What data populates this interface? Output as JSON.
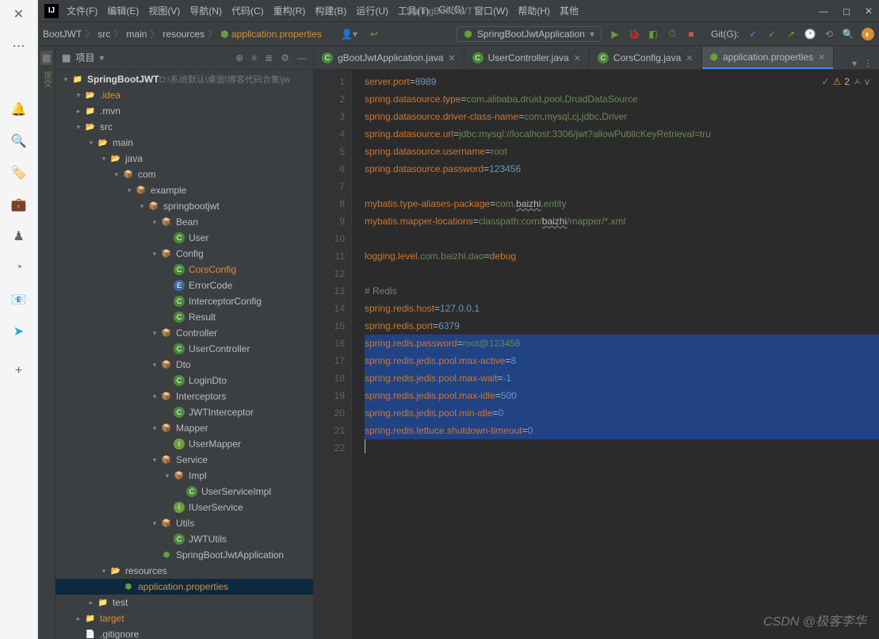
{
  "app_name": "SpringBootJWT",
  "menu": [
    "文件(F)",
    "编辑(E)",
    "视图(V)",
    "导航(N)",
    "代码(C)",
    "重构(R)",
    "构建(B)",
    "运行(U)",
    "工具(T)",
    "Git(G)",
    "窗口(W)",
    "帮助(H)",
    "其他"
  ],
  "crumbs": [
    "BootJWT",
    "src",
    "main",
    "resources",
    "application.properties"
  ],
  "run_config": "SpringBootJwtApplication",
  "git_label": "Git(G):",
  "project_label": "项目",
  "root": {
    "name": "SpringBootJWT",
    "path": "D:\\系统默认\\桌面\\博客代码合集\\jw"
  },
  "tree": [
    {
      "d": 1,
      "t": "folder",
      "open": true,
      "l": ".idea",
      "orange": true
    },
    {
      "d": 1,
      "t": "folder",
      "open": false,
      "l": ".mvn"
    },
    {
      "d": 1,
      "t": "folder",
      "open": true,
      "l": "src"
    },
    {
      "d": 2,
      "t": "folder",
      "open": true,
      "l": "main"
    },
    {
      "d": 3,
      "t": "folder",
      "open": true,
      "l": "java"
    },
    {
      "d": 4,
      "t": "pkg",
      "open": true,
      "l": "com"
    },
    {
      "d": 5,
      "t": "pkg",
      "open": true,
      "l": "example"
    },
    {
      "d": 6,
      "t": "pkg",
      "open": true,
      "l": "springbootjwt"
    },
    {
      "d": 7,
      "t": "pkg",
      "open": true,
      "l": "Bean"
    },
    {
      "d": 8,
      "t": "class",
      "l": "User"
    },
    {
      "d": 7,
      "t": "pkg",
      "open": true,
      "l": "Config"
    },
    {
      "d": 8,
      "t": "class",
      "l": "CorsConfig",
      "orange": true
    },
    {
      "d": 8,
      "t": "enum",
      "l": "ErrorCode"
    },
    {
      "d": 8,
      "t": "class",
      "l": "InterceptorConfig"
    },
    {
      "d": 8,
      "t": "class",
      "l": "Result"
    },
    {
      "d": 7,
      "t": "pkg",
      "open": true,
      "l": "Controller"
    },
    {
      "d": 8,
      "t": "class",
      "l": "UserController"
    },
    {
      "d": 7,
      "t": "pkg",
      "open": true,
      "l": "Dto"
    },
    {
      "d": 8,
      "t": "class",
      "l": "LoginDto"
    },
    {
      "d": 7,
      "t": "pkg",
      "open": true,
      "l": "Interceptors"
    },
    {
      "d": 8,
      "t": "class",
      "l": "JWTInterceptor"
    },
    {
      "d": 7,
      "t": "pkg",
      "open": true,
      "l": "Mapper"
    },
    {
      "d": 8,
      "t": "int",
      "l": "UserMapper"
    },
    {
      "d": 7,
      "t": "pkg",
      "open": true,
      "l": "Service"
    },
    {
      "d": 8,
      "t": "pkg",
      "open": true,
      "l": "Impl"
    },
    {
      "d": 9,
      "t": "class",
      "l": "UserServiceImpl"
    },
    {
      "d": 8,
      "t": "int",
      "l": "IUserService"
    },
    {
      "d": 7,
      "t": "pkg",
      "open": true,
      "l": "Utils"
    },
    {
      "d": 8,
      "t": "class",
      "l": "JWTUtils"
    },
    {
      "d": 7,
      "t": "spring",
      "l": "SpringBootJwtApplication"
    },
    {
      "d": 3,
      "t": "res",
      "open": true,
      "l": "resources"
    },
    {
      "d": 4,
      "t": "prop",
      "l": "application.properties",
      "orange": true,
      "sel": true
    },
    {
      "d": 2,
      "t": "folder",
      "open": false,
      "l": "test"
    },
    {
      "d": 1,
      "t": "folder",
      "open": false,
      "l": "target",
      "orange": true
    },
    {
      "d": 1,
      "t": "file",
      "l": ".gitignore"
    }
  ],
  "tabs": [
    {
      "l": "gBootJwtApplication.java",
      "ic": "class"
    },
    {
      "l": "UserController.java",
      "ic": "class"
    },
    {
      "l": "CorsConfig.java",
      "ic": "class"
    },
    {
      "l": "application.properties",
      "ic": "prop",
      "active": true
    }
  ],
  "warnings": "2",
  "code": [
    [
      [
        "k",
        "server.port"
      ],
      [
        "p",
        "="
      ],
      [
        "n",
        "8989"
      ]
    ],
    [
      [
        "k",
        "spring.datasource.type"
      ],
      [
        "p",
        "="
      ],
      [
        "v",
        "com"
      ],
      [
        "p",
        "."
      ],
      [
        "v",
        "alibaba"
      ],
      [
        "p",
        "."
      ],
      [
        "v",
        "druid"
      ],
      [
        "p",
        "."
      ],
      [
        "v",
        "pool"
      ],
      [
        "p",
        "."
      ],
      [
        "v",
        "DruidDataSource"
      ]
    ],
    [
      [
        "k",
        "spring.datasource.driver-class-name"
      ],
      [
        "p",
        "="
      ],
      [
        "v",
        "com"
      ],
      [
        "p",
        "."
      ],
      [
        "v",
        "mysql"
      ],
      [
        "p",
        "."
      ],
      [
        "v",
        "cj"
      ],
      [
        "p",
        "."
      ],
      [
        "v",
        "jdbc"
      ],
      [
        "p",
        "."
      ],
      [
        "v",
        "Driver"
      ]
    ],
    [
      [
        "k",
        "spring.datasource.url"
      ],
      [
        "p",
        "="
      ],
      [
        "v",
        "jdbc:mysql://localhost:3306/jwt?allowPublicKeyRetrieval=tru"
      ]
    ],
    [
      [
        "k",
        "spring.datasource.username"
      ],
      [
        "p",
        "="
      ],
      [
        "v",
        "root"
      ]
    ],
    [
      [
        "k",
        "spring.datasource.password"
      ],
      [
        "p",
        "="
      ],
      [
        "n",
        "123456"
      ]
    ],
    [],
    [
      [
        "k",
        "mybatis.type-aliases-package"
      ],
      [
        "p",
        "="
      ],
      [
        "v",
        "com"
      ],
      [
        "p",
        "."
      ],
      [
        "w",
        "baizhi"
      ],
      [
        "p",
        "."
      ],
      [
        "v",
        "entity"
      ]
    ],
    [
      [
        "k",
        "mybatis.mapper-locations"
      ],
      [
        "p",
        "="
      ],
      [
        "v",
        "classpath:com/"
      ],
      [
        "w",
        "baizhi"
      ],
      [
        "v",
        "/mapper/*.xml"
      ]
    ],
    [],
    [
      [
        "k",
        "logging.level."
      ],
      [
        "v",
        "com.baizhi.dao"
      ],
      [
        "p",
        "="
      ],
      [
        "k",
        "debug"
      ]
    ],
    [],
    [
      [
        "c",
        "# Redis"
      ]
    ],
    [
      [
        "k",
        "spring.redis.host"
      ],
      [
        "p",
        "="
      ],
      [
        "n",
        "127.0.0.1"
      ]
    ],
    [
      [
        "k",
        "spring.redis.port"
      ],
      [
        "p",
        "="
      ],
      [
        "n",
        "6379"
      ]
    ],
    [
      [
        "k",
        "spring.redis.password"
      ],
      [
        "p",
        "="
      ],
      [
        "v",
        "root@123456"
      ]
    ],
    [
      [
        "k",
        "spring.redis.jedis.pool.max-active"
      ],
      [
        "p",
        "="
      ],
      [
        "n",
        "8"
      ]
    ],
    [
      [
        "k",
        "spring.redis.jedis.pool.max-wait"
      ],
      [
        "p",
        "="
      ],
      [
        "n",
        "-1"
      ]
    ],
    [
      [
        "k",
        "spring.redis.jedis.pool.max-idle"
      ],
      [
        "p",
        "="
      ],
      [
        "n",
        "500"
      ]
    ],
    [
      [
        "k",
        "spring.redis.jedis.pool.min-idle"
      ],
      [
        "p",
        "="
      ],
      [
        "n",
        "0"
      ]
    ],
    [
      [
        "k",
        "spring.redis.lettuce.shutdown-timeout"
      ],
      [
        "p",
        "="
      ],
      [
        "n",
        "0"
      ]
    ],
    []
  ],
  "highlighted_lines": [
    16,
    17,
    18,
    19,
    20,
    21
  ],
  "watermark": "CSDN @极客李华"
}
